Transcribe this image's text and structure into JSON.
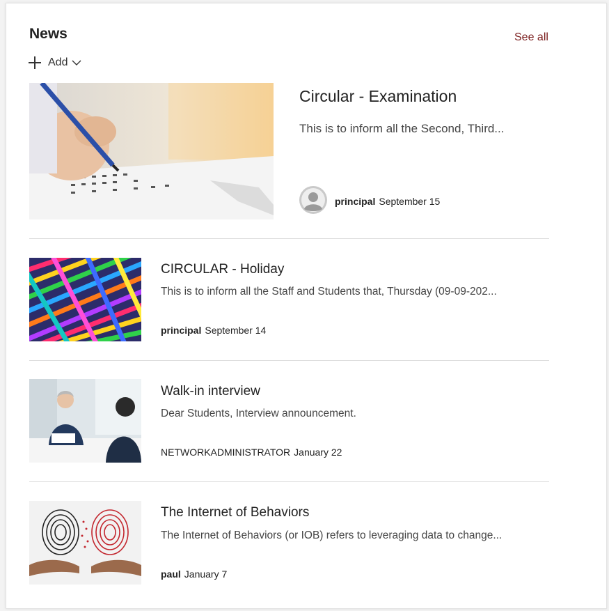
{
  "header": {
    "title": "News",
    "see_all": "See all",
    "add_label": "Add"
  },
  "hero": {
    "title": "Circular - Examination",
    "desc": "This is to inform all the Second, Third...",
    "author": "principal",
    "date": "September 15",
    "image": "exam-pencil-image"
  },
  "items": [
    {
      "title": "CIRCULAR - Holiday",
      "desc": "This is to inform all the Staff and Students that, Thursday (09-09-202...",
      "author": "principal",
      "date": "September 14",
      "image": "colorful-ribbons-image"
    },
    {
      "title": "Walk-in interview",
      "desc": "Dear Students, Interview announcement.",
      "author": "NETWORKADMINISTRATOR",
      "date": "January 22",
      "image": "interview-image"
    },
    {
      "title": "The Internet of Behaviors",
      "desc": "The Internet of Behaviors (or IOB) refers to leveraging data to change...",
      "author": "paul",
      "date": "January 7",
      "image": "fingerprint-hands-image"
    }
  ],
  "colors": {
    "see_all": "#7a1c1c",
    "divider": "#dcdcdc"
  }
}
